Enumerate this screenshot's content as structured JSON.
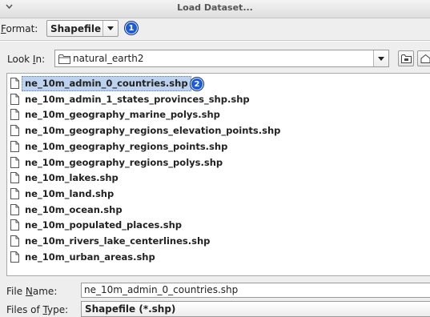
{
  "window": {
    "title": "Load Dataset..."
  },
  "format": {
    "label_mnemonic": "F",
    "label_rest": "ormat:",
    "selected": "Shapefile",
    "badge": "1"
  },
  "look_in": {
    "label_pre": "Look ",
    "label_mnemonic": "I",
    "label_post": "n:",
    "folder": "natural_earth2"
  },
  "files": {
    "badge": "2",
    "items": [
      {
        "name": "ne_10m_admin_0_countries.shp",
        "selected": true
      },
      {
        "name": "ne_10m_admin_1_states_provinces_shp.shp"
      },
      {
        "name": "ne_10m_geography_marine_polys.shp"
      },
      {
        "name": "ne_10m_geography_regions_elevation_points.shp"
      },
      {
        "name": "ne_10m_geography_regions_points.shp"
      },
      {
        "name": "ne_10m_geography_regions_polys.shp"
      },
      {
        "name": "ne_10m_lakes.shp"
      },
      {
        "name": "ne_10m_land.shp"
      },
      {
        "name": "ne_10m_ocean.shp"
      },
      {
        "name": "ne_10m_populated_places.shp"
      },
      {
        "name": "ne_10m_rivers_lake_centerlines.shp"
      },
      {
        "name": "ne_10m_urban_areas.shp"
      }
    ]
  },
  "file_name": {
    "label_pre": "File ",
    "label_mnemonic": "N",
    "label_post": "ame:",
    "value": "ne_10m_admin_0_countries.shp"
  },
  "file_type": {
    "label_pre": "Files of ",
    "label_mnemonic": "T",
    "label_post": "ype:",
    "value": "Shapefile (*.shp)"
  },
  "icons": {
    "title_menu": "chevron-down-icon",
    "folder": "folder-icon",
    "file": "file-icon",
    "up_folder": "up-folder-icon",
    "home": "home-icon"
  },
  "colors": {
    "badge": "#1c5bd8",
    "selection": "#bcd2ee"
  }
}
